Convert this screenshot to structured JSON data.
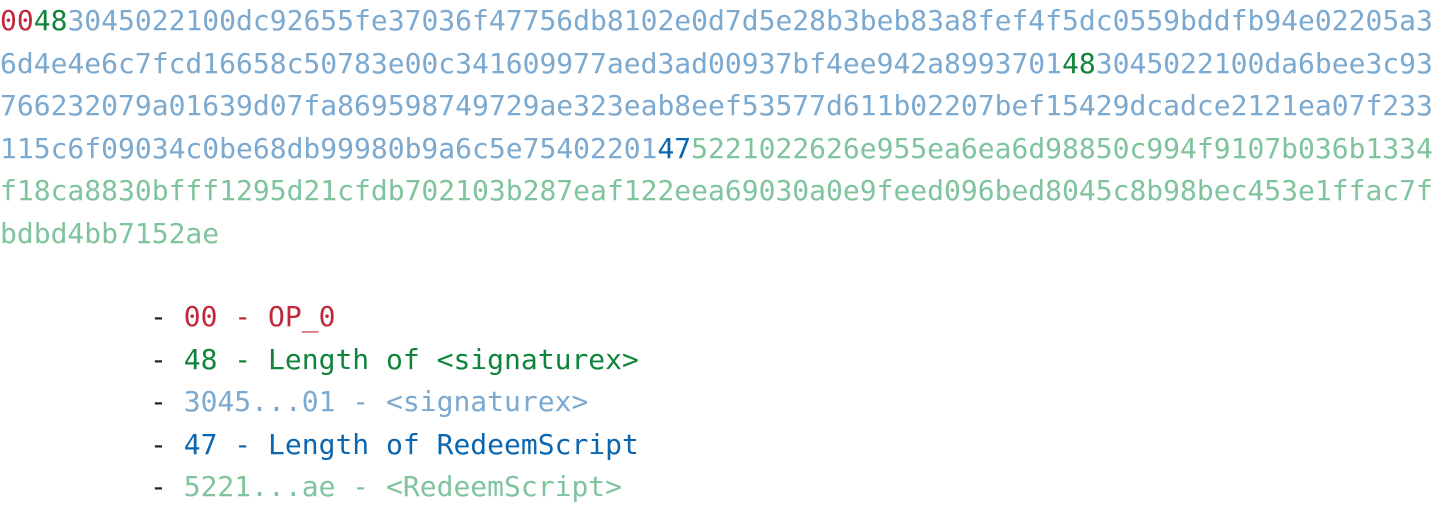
{
  "colors": {
    "op0": "#c0283a",
    "siglen": "#11843c",
    "sig": "#7ba9d0",
    "rslen": "#0b66b0",
    "rs": "#7fc49c",
    "dash": "#222222"
  },
  "hex": {
    "op0": "00",
    "siglen": "48",
    "sig_a": "3045022100dc92655fe37036f47756db8102e0d7d5e28b3beb83a8fef4f5dc0559bddfb94e02205a36d4e4e6c7fcd16658c50783e00c341609977aed3ad00937bf4ee942a8993701",
    "siglen2": "48",
    "sig_b": "3045022100da6bee3c93766232079a01639d07fa869598749729ae323eab8eef53577d611b02207bef15429dcadce2121ea07f233115c6f09034c0be68db99980b9a6c5e75402201",
    "rslen": "47",
    "rs": "5221022626e955ea6ea6d98850c994f9107b036b1334f18ca8830bfff1295d21cfdb702103b287eaf122eea69030a0e9feed096bed8045c8b98bec453e1ffac7fbdbd4bb7152ae"
  },
  "legend": [
    {
      "dash": "- ",
      "code": "00",
      "sep": " - ",
      "desc": "OP_0",
      "color": "op0"
    },
    {
      "dash": "- ",
      "code": "48",
      "sep": " - ",
      "desc": "Length of <signaturex>",
      "color": "siglen"
    },
    {
      "dash": "- ",
      "code": "3045...01",
      "sep": " - ",
      "desc": "<signaturex>",
      "color": "sig"
    },
    {
      "dash": "- ",
      "code": "47",
      "sep": " - ",
      "desc": "Length of RedeemScript",
      "color": "rslen"
    },
    {
      "dash": "- ",
      "code": "5221...ae",
      "sep": " - ",
      "desc": "<RedeemScript>",
      "color": "rs"
    }
  ]
}
